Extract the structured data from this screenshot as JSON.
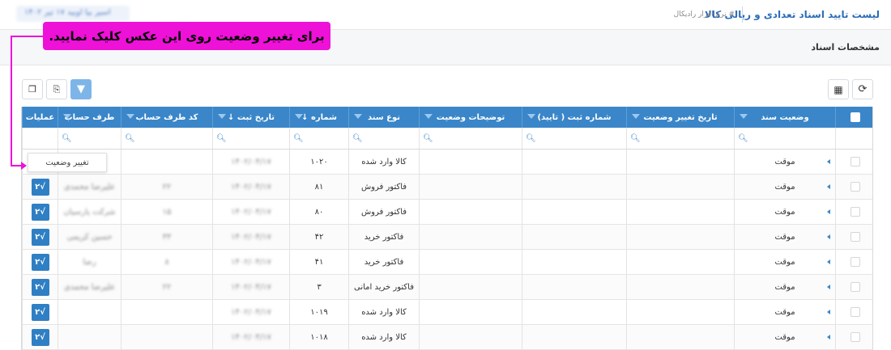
{
  "header": {
    "title": "لیست تایید اسناد تعدادی و ریالی کالا",
    "breadcrumb": "# نرم افزار رادیکال",
    "top_left_chip": "اسیر بیا اوبید ۱۷ تیر ۱۴۰۲"
  },
  "section_title": "مشخصات اسناد",
  "toolbar": {
    "refresh_icon": "refresh-icon",
    "columns_icon": "columns-icon",
    "filter_icon": "filter-icon",
    "export_icon": "export-icon",
    "copy_icon": "copy-icon"
  },
  "columns": {
    "status": "وضعیت سند",
    "status_change_date": "تاریخ تغییر وضعیت",
    "reg_number": "شماره ثبت ( تایید)",
    "status_desc": "توضیحات وضعیت",
    "doc_type": "نوع سند",
    "number": "شماره ↓",
    "reg_date": "تاریخ ثبت ↓",
    "party_code": "کد طرف حساب",
    "party": "طرف حساب",
    "ops": "عملیات"
  },
  "rows": [
    {
      "status": "موقت",
      "doc_type": "کالا وارد شده",
      "number": "۱۰۲۰",
      "reg_date": "۱۴۰۲/۰۴/۱۷",
      "party_code": "",
      "party": ""
    },
    {
      "status": "موقت",
      "doc_type": "فاکتور فروش",
      "number": "۸۱",
      "reg_date": "۱۴۰۲/۰۴/۱۷",
      "party_code": "۲۲",
      "party": "علیرضا محمدی"
    },
    {
      "status": "موقت",
      "doc_type": "فاکتور فروش",
      "number": "۸۰",
      "reg_date": "۱۴۰۲/۰۴/۱۷",
      "party_code": "۱۵",
      "party": "شرکت پارسیان"
    },
    {
      "status": "موقت",
      "doc_type": "فاکتور خرید",
      "number": "۴۲",
      "reg_date": "۱۴۰۲/۰۴/۱۷",
      "party_code": "۳۳",
      "party": "حسین کریمی"
    },
    {
      "status": "موقت",
      "doc_type": "فاکتور خرید",
      "number": "۴۱",
      "reg_date": "۱۴۰۲/۰۴/۱۷",
      "party_code": "۸",
      "party": "رضا"
    },
    {
      "status": "موقت",
      "doc_type": "فاکتور خرید امانی",
      "number": "۳",
      "reg_date": "۱۴۰۲/۰۴/۱۷",
      "party_code": "۲۲",
      "party": "علیرضا محمدی"
    },
    {
      "status": "موقت",
      "doc_type": "کالا وارد شده",
      "number": "۱۰۱۹",
      "reg_date": "۱۴۰۲/۰۴/۱۷",
      "party_code": "",
      "party": ""
    },
    {
      "status": "موقت",
      "doc_type": "کالا وارد شده",
      "number": "۱۰۱۸",
      "reg_date": "۱۴۰۲/۰۴/۱۷",
      "party_code": "",
      "party": ""
    }
  ],
  "ops_button_label": "√۲",
  "callout": "برای تغییر وضعیت روی این عکس کلیک نمایید.",
  "tooltip": "تغییر وضعیت",
  "colors": {
    "header_blue": "#3a86c8",
    "callout_magenta": "#ee11d8"
  }
}
